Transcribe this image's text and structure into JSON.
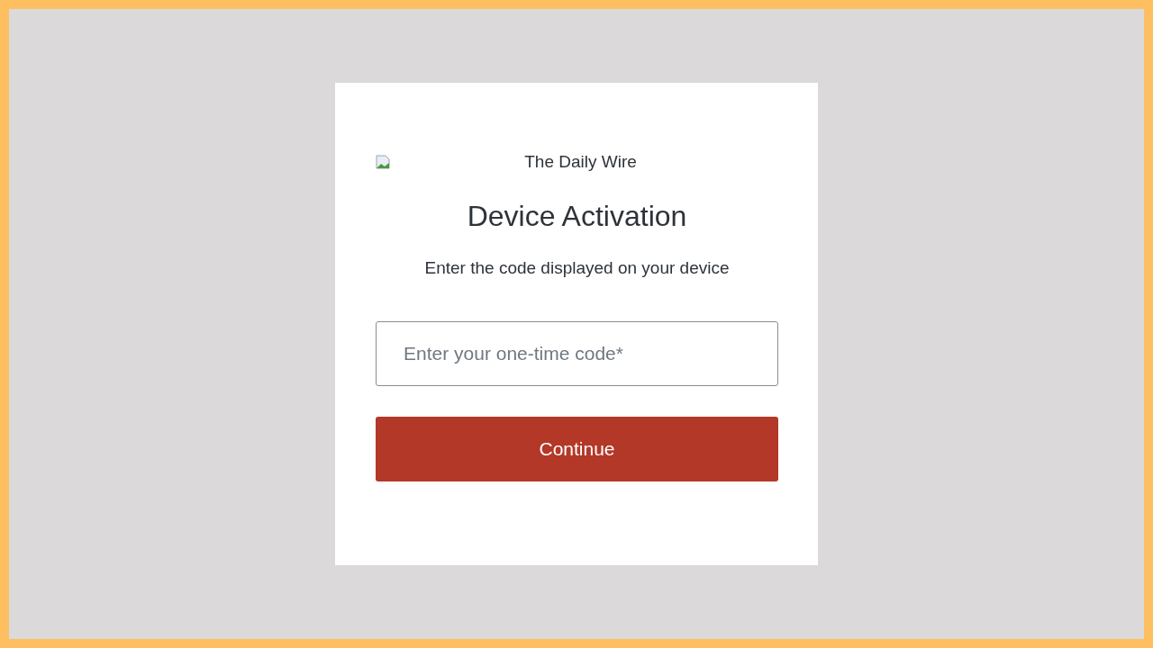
{
  "logo": {
    "alt_text": "The Daily Wire"
  },
  "title": "Device Activation",
  "subtitle": "Enter the code displayed on your device",
  "code_field": {
    "placeholder": "Enter your one-time code*"
  },
  "button": "Continue"
}
